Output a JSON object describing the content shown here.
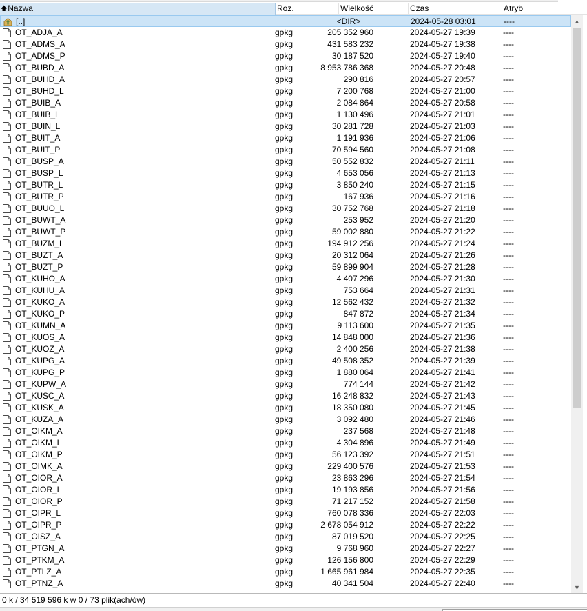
{
  "columns": {
    "name": "Nazwa",
    "ext": "Roz.",
    "size": "Wielkość",
    "time": "Czas",
    "attr": "Atryb"
  },
  "icons": {
    "sort": "sort-ascending-arrow-icon",
    "parent": "parent-folder-up-icon",
    "file": "file-icon"
  },
  "parent_row": {
    "name": "[..]",
    "size": "<DIR>",
    "time": "2024-05-28 03:01",
    "attr": "----"
  },
  "files": [
    {
      "name": "OT_ADJA_A",
      "ext": "gpkg",
      "size": "205 352 960",
      "time": "2024-05-27 19:39",
      "attr": "----"
    },
    {
      "name": "OT_ADMS_A",
      "ext": "gpkg",
      "size": "431 583 232",
      "time": "2024-05-27 19:38",
      "attr": "----"
    },
    {
      "name": "OT_ADMS_P",
      "ext": "gpkg",
      "size": "30 187 520",
      "time": "2024-05-27 19:40",
      "attr": "----"
    },
    {
      "name": "OT_BUBD_A",
      "ext": "gpkg",
      "size": "8 953 786 368",
      "time": "2024-05-27 20:48",
      "attr": "----"
    },
    {
      "name": "OT_BUHD_A",
      "ext": "gpkg",
      "size": "290 816",
      "time": "2024-05-27 20:57",
      "attr": "----"
    },
    {
      "name": "OT_BUHD_L",
      "ext": "gpkg",
      "size": "7 200 768",
      "time": "2024-05-27 21:00",
      "attr": "----"
    },
    {
      "name": "OT_BUIB_A",
      "ext": "gpkg",
      "size": "2 084 864",
      "time": "2024-05-27 20:58",
      "attr": "----"
    },
    {
      "name": "OT_BUIB_L",
      "ext": "gpkg",
      "size": "1 130 496",
      "time": "2024-05-27 21:01",
      "attr": "----"
    },
    {
      "name": "OT_BUIN_L",
      "ext": "gpkg",
      "size": "30 281 728",
      "time": "2024-05-27 21:03",
      "attr": "----"
    },
    {
      "name": "OT_BUIT_A",
      "ext": "gpkg",
      "size": "1 191 936",
      "time": "2024-05-27 21:06",
      "attr": "----"
    },
    {
      "name": "OT_BUIT_P",
      "ext": "gpkg",
      "size": "70 594 560",
      "time": "2024-05-27 21:08",
      "attr": "----"
    },
    {
      "name": "OT_BUSP_A",
      "ext": "gpkg",
      "size": "50 552 832",
      "time": "2024-05-27 21:11",
      "attr": "----"
    },
    {
      "name": "OT_BUSP_L",
      "ext": "gpkg",
      "size": "4 653 056",
      "time": "2024-05-27 21:13",
      "attr": "----"
    },
    {
      "name": "OT_BUTR_L",
      "ext": "gpkg",
      "size": "3 850 240",
      "time": "2024-05-27 21:15",
      "attr": "----"
    },
    {
      "name": "OT_BUTR_P",
      "ext": "gpkg",
      "size": "167 936",
      "time": "2024-05-27 21:16",
      "attr": "----"
    },
    {
      "name": "OT_BUUO_L",
      "ext": "gpkg",
      "size": "30 752 768",
      "time": "2024-05-27 21:18",
      "attr": "----"
    },
    {
      "name": "OT_BUWT_A",
      "ext": "gpkg",
      "size": "253 952",
      "time": "2024-05-27 21:20",
      "attr": "----"
    },
    {
      "name": "OT_BUWT_P",
      "ext": "gpkg",
      "size": "59 002 880",
      "time": "2024-05-27 21:22",
      "attr": "----"
    },
    {
      "name": "OT_BUZM_L",
      "ext": "gpkg",
      "size": "194 912 256",
      "time": "2024-05-27 21:24",
      "attr": "----"
    },
    {
      "name": "OT_BUZT_A",
      "ext": "gpkg",
      "size": "20 312 064",
      "time": "2024-05-27 21:26",
      "attr": "----"
    },
    {
      "name": "OT_BUZT_P",
      "ext": "gpkg",
      "size": "59 899 904",
      "time": "2024-05-27 21:28",
      "attr": "----"
    },
    {
      "name": "OT_KUHO_A",
      "ext": "gpkg",
      "size": "4 407 296",
      "time": "2024-05-27 21:30",
      "attr": "----"
    },
    {
      "name": "OT_KUHU_A",
      "ext": "gpkg",
      "size": "753 664",
      "time": "2024-05-27 21:31",
      "attr": "----"
    },
    {
      "name": "OT_KUKO_A",
      "ext": "gpkg",
      "size": "12 562 432",
      "time": "2024-05-27 21:32",
      "attr": "----"
    },
    {
      "name": "OT_KUKO_P",
      "ext": "gpkg",
      "size": "847 872",
      "time": "2024-05-27 21:34",
      "attr": "----"
    },
    {
      "name": "OT_KUMN_A",
      "ext": "gpkg",
      "size": "9 113 600",
      "time": "2024-05-27 21:35",
      "attr": "----"
    },
    {
      "name": "OT_KUOS_A",
      "ext": "gpkg",
      "size": "14 848 000",
      "time": "2024-05-27 21:36",
      "attr": "----"
    },
    {
      "name": "OT_KUOZ_A",
      "ext": "gpkg",
      "size": "2 400 256",
      "time": "2024-05-27 21:38",
      "attr": "----"
    },
    {
      "name": "OT_KUPG_A",
      "ext": "gpkg",
      "size": "49 508 352",
      "time": "2024-05-27 21:39",
      "attr": "----"
    },
    {
      "name": "OT_KUPG_P",
      "ext": "gpkg",
      "size": "1 880 064",
      "time": "2024-05-27 21:41",
      "attr": "----"
    },
    {
      "name": "OT_KUPW_A",
      "ext": "gpkg",
      "size": "774 144",
      "time": "2024-05-27 21:42",
      "attr": "----"
    },
    {
      "name": "OT_KUSC_A",
      "ext": "gpkg",
      "size": "16 248 832",
      "time": "2024-05-27 21:43",
      "attr": "----"
    },
    {
      "name": "OT_KUSK_A",
      "ext": "gpkg",
      "size": "18 350 080",
      "time": "2024-05-27 21:45",
      "attr": "----"
    },
    {
      "name": "OT_KUZA_A",
      "ext": "gpkg",
      "size": "3 092 480",
      "time": "2024-05-27 21:46",
      "attr": "----"
    },
    {
      "name": "OT_OIKM_A",
      "ext": "gpkg",
      "size": "237 568",
      "time": "2024-05-27 21:48",
      "attr": "----"
    },
    {
      "name": "OT_OIKM_L",
      "ext": "gpkg",
      "size": "4 304 896",
      "time": "2024-05-27 21:49",
      "attr": "----"
    },
    {
      "name": "OT_OIKM_P",
      "ext": "gpkg",
      "size": "56 123 392",
      "time": "2024-05-27 21:51",
      "attr": "----"
    },
    {
      "name": "OT_OIMK_A",
      "ext": "gpkg",
      "size": "229 400 576",
      "time": "2024-05-27 21:53",
      "attr": "----"
    },
    {
      "name": "OT_OIOR_A",
      "ext": "gpkg",
      "size": "23 863 296",
      "time": "2024-05-27 21:54",
      "attr": "----"
    },
    {
      "name": "OT_OIOR_L",
      "ext": "gpkg",
      "size": "19 193 856",
      "time": "2024-05-27 21:56",
      "attr": "----"
    },
    {
      "name": "OT_OIOR_P",
      "ext": "gpkg",
      "size": "71 217 152",
      "time": "2024-05-27 21:58",
      "attr": "----"
    },
    {
      "name": "OT_OIPR_L",
      "ext": "gpkg",
      "size": "760 078 336",
      "time": "2024-05-27 22:03",
      "attr": "----"
    },
    {
      "name": "OT_OIPR_P",
      "ext": "gpkg",
      "size": "2 678 054 912",
      "time": "2024-05-27 22:22",
      "attr": "----"
    },
    {
      "name": "OT_OISZ_A",
      "ext": "gpkg",
      "size": "87 019 520",
      "time": "2024-05-27 22:25",
      "attr": "----"
    },
    {
      "name": "OT_PTGN_A",
      "ext": "gpkg",
      "size": "9 768 960",
      "time": "2024-05-27 22:27",
      "attr": "----"
    },
    {
      "name": "OT_PTKM_A",
      "ext": "gpkg",
      "size": "126 156 800",
      "time": "2024-05-27 22:29",
      "attr": "----"
    },
    {
      "name": "OT_PTLZ_A",
      "ext": "gpkg",
      "size": "1 665 961 984",
      "time": "2024-05-27 22:35",
      "attr": "----"
    },
    {
      "name": "OT_PTNZ_A",
      "ext": "gpkg",
      "size": "40 341 504",
      "time": "2024-05-27 22:40",
      "attr": "----"
    }
  ],
  "status": "0 k / 34 519 596 k w 0 / 73 plik(ach/ów)",
  "colors": {
    "header_selected": "#d6e7f5",
    "row_selected": "#cce4f7",
    "scroll_thumb": "#cdcdcd"
  }
}
